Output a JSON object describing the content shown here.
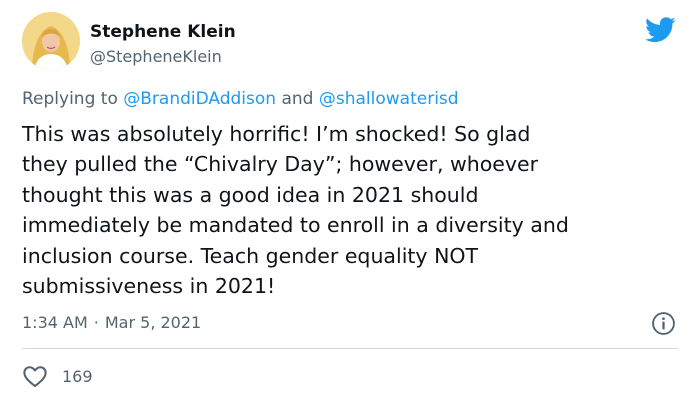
{
  "author": {
    "name": "Stephene Klein",
    "handle": "@StepheneKlein"
  },
  "reply": {
    "prefix": "Replying to",
    "mention_1": "@BrandiDAddison",
    "conjunction": "and",
    "mention_2": "@shallowaterisd"
  },
  "tweet": {
    "text": "This was absolutely horrific! I’m shocked! So glad\nthey pulled the “Chivalry Day”; however, whoever\nthought this was a good idea in 2021 should\nimmediately be mandated to enroll in a diversity and\ninclusion course. Teach gender equality NOT\nsubmissiveness in 2021!"
  },
  "meta": {
    "time": "1:34 AM",
    "separator": "·",
    "date": "Mar 5, 2021"
  },
  "actions": {
    "like_count": "169"
  },
  "icons": {
    "platform": "twitter-bird-icon",
    "info": "info-icon",
    "like": "heart-icon"
  },
  "colors": {
    "brand": "#1d9bf0",
    "text": "#0f1419",
    "muted": "#536471",
    "divider": "#cfd9de"
  }
}
